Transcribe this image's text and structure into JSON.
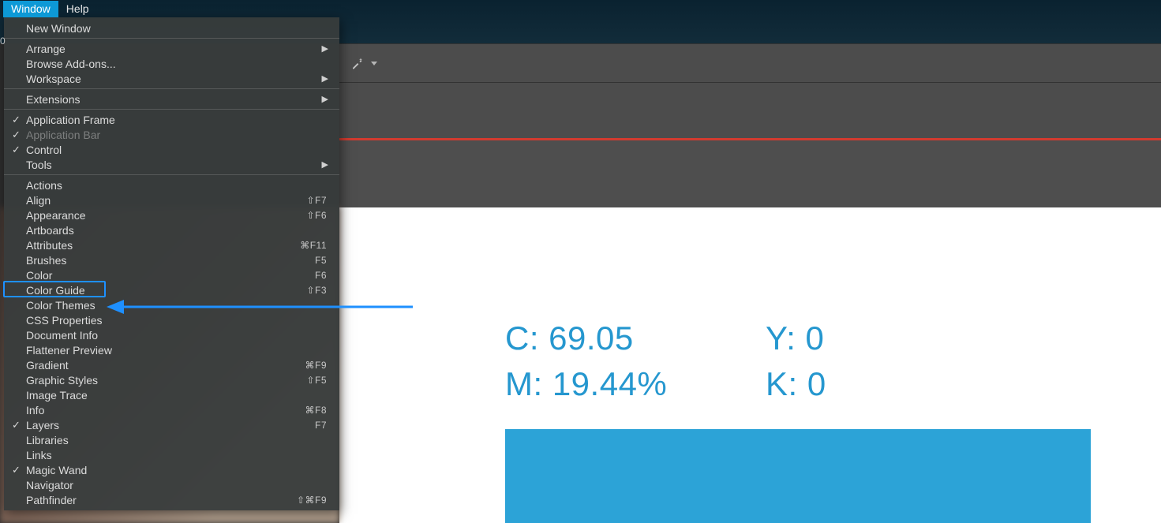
{
  "menubar": {
    "active": "Window",
    "other": "Help"
  },
  "edge_marker": "0",
  "menu_sections": [
    {
      "items": [
        {
          "label": "New Window"
        }
      ]
    },
    {
      "items": [
        {
          "label": "Arrange",
          "hasSub": true
        },
        {
          "label": "Browse Add-ons..."
        },
        {
          "label": "Workspace",
          "hasSub": true
        }
      ]
    },
    {
      "items": [
        {
          "label": "Extensions",
          "hasSub": true
        }
      ]
    },
    {
      "items": [
        {
          "label": "Application Frame",
          "checked": true
        },
        {
          "label": "Application Bar",
          "checked": true,
          "dim": true
        },
        {
          "label": "Control",
          "checked": true
        },
        {
          "label": "Tools",
          "hasSub": true
        }
      ]
    },
    {
      "items": [
        {
          "label": "Actions"
        },
        {
          "label": "Align",
          "shortcut": "⇧F7"
        },
        {
          "label": "Appearance",
          "shortcut": "⇧F6"
        },
        {
          "label": "Artboards"
        },
        {
          "label": "Attributes",
          "shortcut": "⌘F11"
        },
        {
          "label": "Brushes",
          "shortcut": "F5"
        },
        {
          "label": "Color",
          "shortcut": "F6"
        },
        {
          "label": "Color Guide",
          "shortcut": "⇧F3",
          "highlighted": true
        },
        {
          "label": "Color Themes"
        },
        {
          "label": "CSS Properties"
        },
        {
          "label": "Document Info"
        },
        {
          "label": "Flattener Preview"
        },
        {
          "label": "Gradient",
          "shortcut": "⌘F9"
        },
        {
          "label": "Graphic Styles",
          "shortcut": "⇧F5"
        },
        {
          "label": "Image Trace"
        },
        {
          "label": "Info",
          "shortcut": "⌘F8"
        },
        {
          "label": "Layers",
          "shortcut": "F7",
          "checked": true
        },
        {
          "label": "Libraries"
        },
        {
          "label": "Links"
        },
        {
          "label": "Magic Wand",
          "checked": true
        },
        {
          "label": "Navigator"
        },
        {
          "label": "Pathfinder",
          "shortcut": "⇧⌘F9"
        }
      ]
    }
  ],
  "cmyk": {
    "c": "C: 69.05",
    "y": "Y: 0",
    "m": "M: 19.44%",
    "k": "K: 0"
  },
  "colors": {
    "accent": "#2ca3d7",
    "redRule": "#d23b2f",
    "highlight": "#1e90ff"
  }
}
